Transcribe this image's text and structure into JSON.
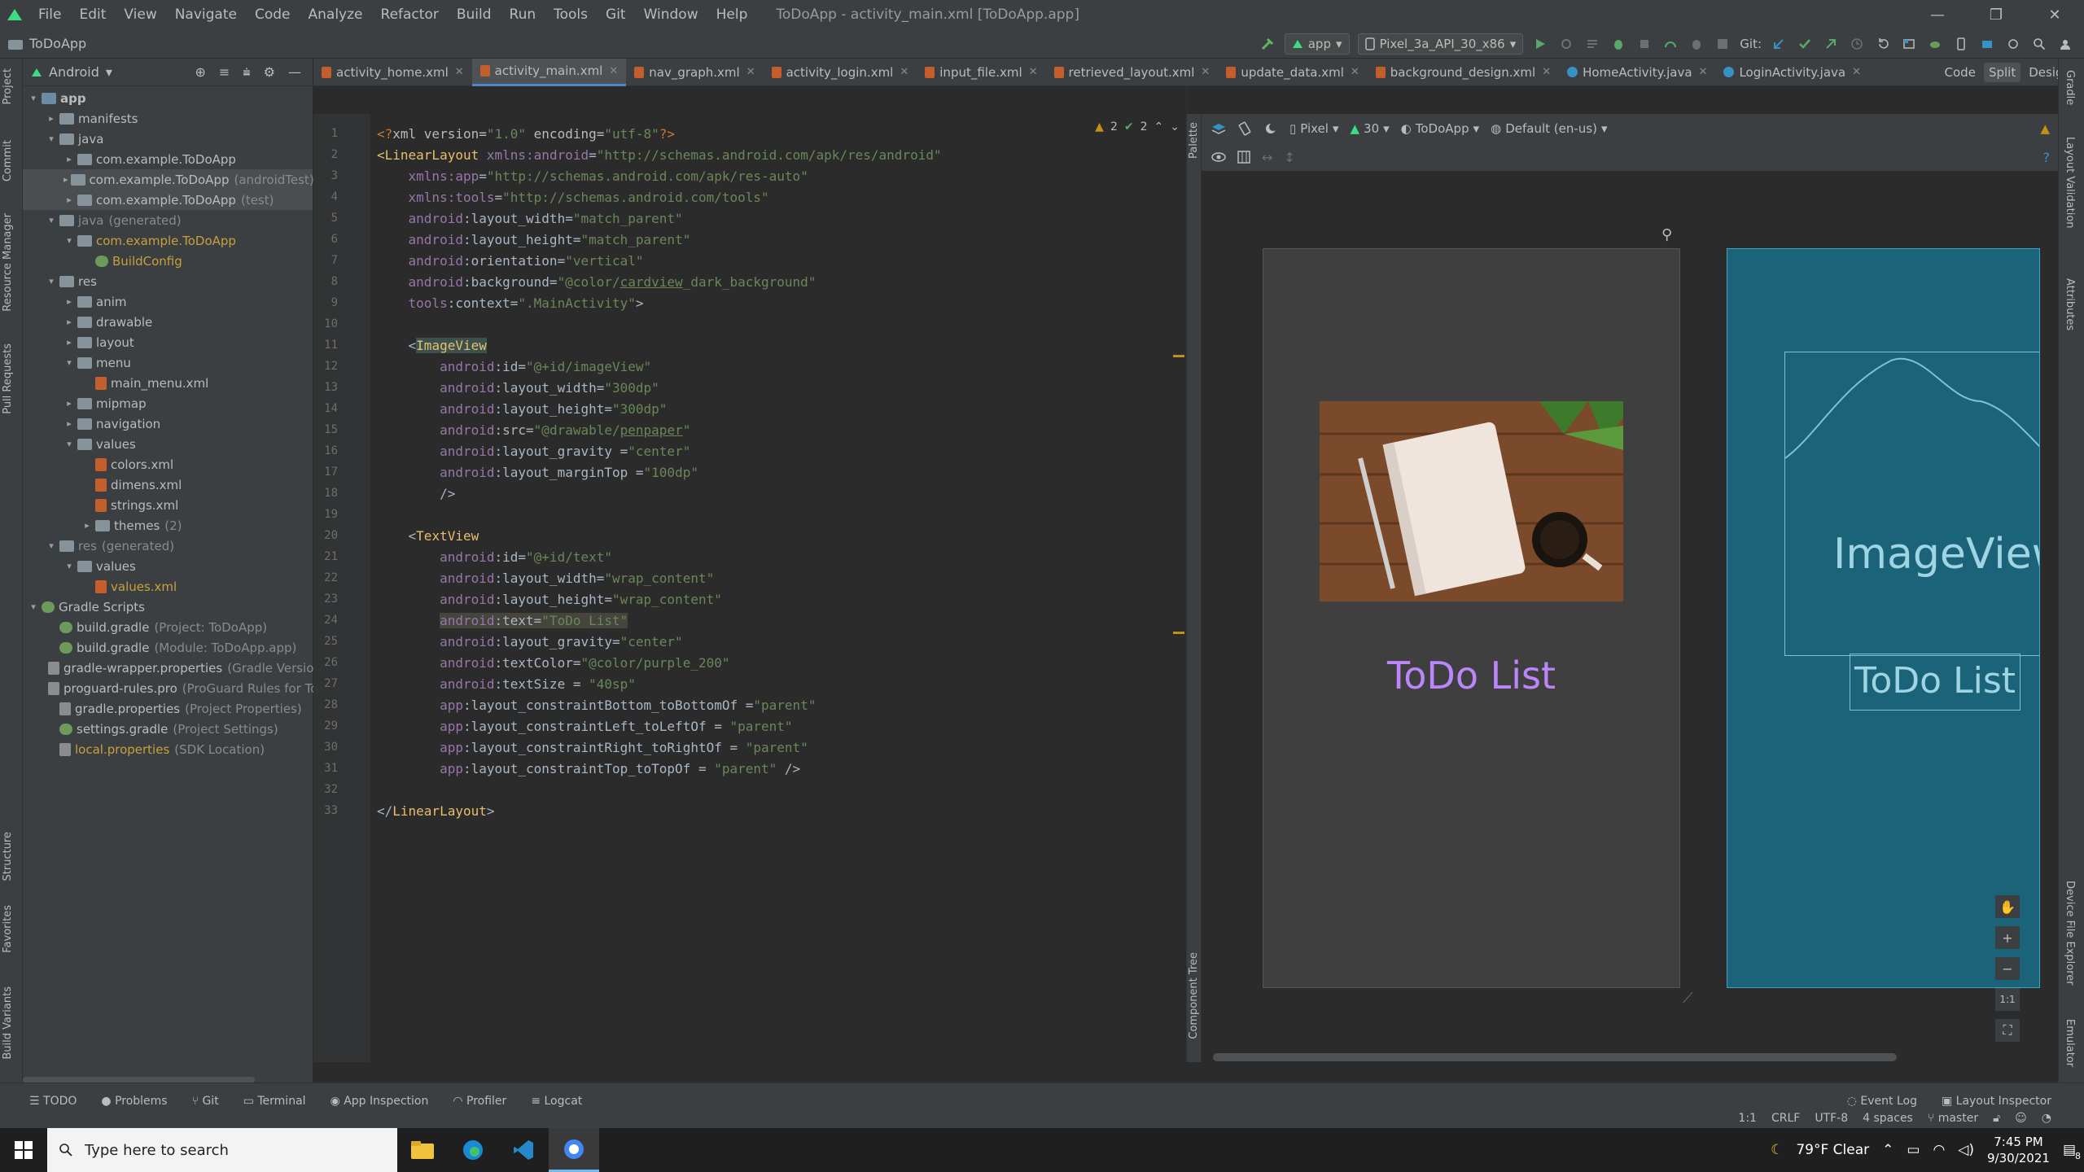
{
  "menubar": {
    "items": [
      "File",
      "Edit",
      "View",
      "Navigate",
      "Code",
      "Analyze",
      "Refactor",
      "Build",
      "Run",
      "Tools",
      "Git",
      "Window",
      "Help"
    ],
    "title": "ToDoApp - activity_main.xml [ToDoApp.app]",
    "controls": [
      "—",
      "❐",
      "✕"
    ]
  },
  "navbar": {
    "project_name": "ToDoApp",
    "run_config": "app",
    "device": "Pixel_3a_API_30_x86",
    "git_label": "Git:"
  },
  "left_stripe": [
    "Project",
    "Commit",
    "Resource Manager",
    "Pull Requests",
    "Structure",
    "Favorites",
    "Build Variants"
  ],
  "right_stripe": [
    "Gradle",
    "Layout Validation",
    "Attributes",
    "Device File Explorer",
    "Emulator"
  ],
  "project_panel": {
    "view_mode": "Android",
    "tree": [
      {
        "depth": 0,
        "arrow": "▾",
        "icon": "folder-b",
        "label": "app",
        "bold": true
      },
      {
        "depth": 1,
        "arrow": "▸",
        "icon": "folder",
        "label": "manifests"
      },
      {
        "depth": 1,
        "arrow": "▾",
        "icon": "folder",
        "label": "java"
      },
      {
        "depth": 2,
        "arrow": "▸",
        "icon": "folder",
        "label": "com.example.ToDoApp"
      },
      {
        "depth": 2,
        "arrow": "▸",
        "icon": "folder",
        "label": "com.example.ToDoApp",
        "hint": "(androidTest)",
        "sel": true
      },
      {
        "depth": 2,
        "arrow": "▸",
        "icon": "folder",
        "label": "com.example.ToDoApp",
        "hint": "(test)",
        "sel": true
      },
      {
        "depth": 1,
        "arrow": "▾",
        "icon": "folder",
        "label": "java",
        "hint": "(generated)",
        "muted": true
      },
      {
        "depth": 2,
        "arrow": "▾",
        "icon": "folder",
        "label": "com.example.ToDoApp",
        "yellow": true
      },
      {
        "depth": 3,
        "arrow": "",
        "icon": "gradle",
        "label": "BuildConfig",
        "yellow": true
      },
      {
        "depth": 1,
        "arrow": "▾",
        "icon": "folder",
        "label": "res"
      },
      {
        "depth": 2,
        "arrow": "▸",
        "icon": "folder",
        "label": "anim"
      },
      {
        "depth": 2,
        "arrow": "▸",
        "icon": "folder",
        "label": "drawable"
      },
      {
        "depth": 2,
        "arrow": "▸",
        "icon": "folder",
        "label": "layout"
      },
      {
        "depth": 2,
        "arrow": "▾",
        "icon": "folder",
        "label": "menu"
      },
      {
        "depth": 3,
        "arrow": "",
        "icon": "xml",
        "label": "main_menu.xml"
      },
      {
        "depth": 2,
        "arrow": "▸",
        "icon": "folder",
        "label": "mipmap"
      },
      {
        "depth": 2,
        "arrow": "▸",
        "icon": "folder",
        "label": "navigation"
      },
      {
        "depth": 2,
        "arrow": "▾",
        "icon": "folder",
        "label": "values"
      },
      {
        "depth": 3,
        "arrow": "",
        "icon": "xml",
        "label": "colors.xml"
      },
      {
        "depth": 3,
        "arrow": "",
        "icon": "xml",
        "label": "dimens.xml"
      },
      {
        "depth": 3,
        "arrow": "",
        "icon": "xml",
        "label": "strings.xml"
      },
      {
        "depth": 3,
        "arrow": "▸",
        "icon": "folder",
        "label": "themes",
        "hint": "(2)"
      },
      {
        "depth": 1,
        "arrow": "▾",
        "icon": "folder",
        "label": "res",
        "hint": "(generated)",
        "muted": true
      },
      {
        "depth": 2,
        "arrow": "▾",
        "icon": "folder",
        "label": "values"
      },
      {
        "depth": 3,
        "arrow": "",
        "icon": "xml",
        "label": "values.xml",
        "yellow": true
      },
      {
        "depth": 0,
        "arrow": "▾",
        "icon": "gradle",
        "label": "Gradle Scripts"
      },
      {
        "depth": 1,
        "arrow": "",
        "icon": "gradle",
        "label": "build.gradle",
        "hint": "(Project: ToDoApp)"
      },
      {
        "depth": 1,
        "arrow": "",
        "icon": "gradle",
        "label": "build.gradle",
        "hint": "(Module: ToDoApp.app)"
      },
      {
        "depth": 1,
        "arrow": "",
        "icon": "props",
        "label": "gradle-wrapper.properties",
        "hint": "(Gradle Version"
      },
      {
        "depth": 1,
        "arrow": "",
        "icon": "props",
        "label": "proguard-rules.pro",
        "hint": "(ProGuard Rules for To"
      },
      {
        "depth": 1,
        "arrow": "",
        "icon": "props",
        "label": "gradle.properties",
        "hint": "(Project Properties)"
      },
      {
        "depth": 1,
        "arrow": "",
        "icon": "gradle",
        "label": "settings.gradle",
        "hint": "(Project Settings)"
      },
      {
        "depth": 1,
        "arrow": "",
        "icon": "props",
        "label": "local.properties",
        "hint": "(SDK Location)",
        "yellow": true
      }
    ]
  },
  "tabs": [
    {
      "label": "activity_home.xml",
      "kind": "xml"
    },
    {
      "label": "activity_main.xml",
      "kind": "xml",
      "active": true
    },
    {
      "label": "nav_graph.xml",
      "kind": "xml"
    },
    {
      "label": "activity_login.xml",
      "kind": "xml"
    },
    {
      "label": "input_file.xml",
      "kind": "xml"
    },
    {
      "label": "retrieved_layout.xml",
      "kind": "xml"
    },
    {
      "label": "update_data.xml",
      "kind": "xml"
    },
    {
      "label": "background_design.xml",
      "kind": "xml"
    },
    {
      "label": "HomeActivity.java",
      "kind": "java"
    },
    {
      "label": "LoginActivity.java",
      "kind": "java"
    }
  ],
  "view_modes": {
    "code": "Code",
    "split": "Split",
    "design": "Design"
  },
  "inspection": {
    "warnings": "2",
    "weak": "2"
  },
  "code_lines": [
    {
      "n": "1",
      "html": "<span class='t-pi'>&lt;?</span><span class='t-attr'>xml version=</span><span class='t-val'>\"1.0\"</span><span class='t-attr'> encoding=</span><span class='t-val'>\"utf-8\"</span><span class='t-pi'>?&gt;</span>"
    },
    {
      "n": "2",
      "html": "<span class='t-tag'>&lt;LinearLayout</span> <span class='t-ns'>xmlns:android</span>=<span class='t-val'>\"http://schemas.android.com/apk/res/android\"</span>"
    },
    {
      "n": "3",
      "html": "    <span class='t-ns'>xmlns:app</span>=<span class='t-val'>\"http://schemas.android.com/apk/res-auto\"</span>"
    },
    {
      "n": "4",
      "html": "    <span class='t-ns'>xmlns:tools</span>=<span class='t-val'>\"http://schemas.android.com/tools\"</span>"
    },
    {
      "n": "5",
      "html": "    <span class='t-ns'>android</span>:layout_width=<span class='t-val'>\"match_parent\"</span>"
    },
    {
      "n": "6",
      "html": "    <span class='t-ns'>android</span>:layout_height=<span class='t-val'>\"match_parent\"</span>"
    },
    {
      "n": "7",
      "html": "    <span class='t-ns'>android</span>:orientation=<span class='t-val'>\"vertical\"</span>"
    },
    {
      "n": "8",
      "html": "    <span class='t-ns'>android</span>:background=<span class='t-val'>\"@color/<u>cardview</u>_dark_background\"</span>"
    },
    {
      "n": "9",
      "html": "    <span class='t-ns'>tools</span>:context=<span class='t-val'>\".MainActivity\"</span>&gt;"
    },
    {
      "n": "10",
      "html": ""
    },
    {
      "n": "11",
      "html": "    &lt;<span class='t-tag hl-tag'>ImageView</span>"
    },
    {
      "n": "12",
      "html": "        <span class='t-ns'>android</span>:id=<span class='t-val'>\"@+id/imageView\"</span>"
    },
    {
      "n": "13",
      "html": "        <span class='t-ns'>android</span>:layout_width=<span class='t-val'>\"300dp\"</span>"
    },
    {
      "n": "14",
      "html": "        <span class='t-ns'>android</span>:layout_height=<span class='t-val'>\"300dp\"</span>"
    },
    {
      "n": "15",
      "html": "        <span class='t-ns'>android</span>:src=<span class='t-val'>\"@drawable/<u>penpaper</u>\"</span>"
    },
    {
      "n": "16",
      "html": "        <span class='t-ns'>android</span>:layout_gravity =<span class='t-val'>\"center\"</span>"
    },
    {
      "n": "17",
      "html": "        <span class='t-ns'>android</span>:layout_marginTop =<span class='t-val'>\"100dp\"</span>"
    },
    {
      "n": "18",
      "html": "        /&gt;"
    },
    {
      "n": "19",
      "html": ""
    },
    {
      "n": "20",
      "html": "    &lt;<span class='t-tag'>TextView</span>"
    },
    {
      "n": "21",
      "html": "        <span class='t-ns'>android</span>:id=<span class='t-val'>\"@+id/text\"</span>"
    },
    {
      "n": "22",
      "html": "        <span class='t-ns'>android</span>:layout_width=<span class='t-val'>\"wrap_content\"</span>"
    },
    {
      "n": "23",
      "html": "        <span class='t-ns'>android</span>:layout_height=<span class='t-val'>\"wrap_content\"</span>"
    },
    {
      "n": "24",
      "html": "        <span class='hl-text'><span class='t-ns'>android</span>:text=<span class='t-val'>\"ToDo List\"</span></span>"
    },
    {
      "n": "25",
      "html": "        <span class='t-ns'>android</span>:layout_gravity=<span class='t-val'>\"center\"</span>"
    },
    {
      "n": "26",
      "html": "        <span class='t-ns'>android</span>:textColor=<span class='t-val'>\"@color/purple_200\"</span>"
    },
    {
      "n": "27",
      "html": "        <span class='t-ns'>android</span>:textSize = <span class='t-val'>\"40sp\"</span>"
    },
    {
      "n": "28",
      "html": "        <span class='t-ns'>app</span>:layout_constraintBottom_toBottomOf =<span class='t-val'>\"parent\"</span>"
    },
    {
      "n": "29",
      "html": "        <span class='t-ns'>app</span>:layout_constraintLeft_toLeftOf = <span class='t-val'>\"parent\"</span>"
    },
    {
      "n": "30",
      "html": "        <span class='t-ns'>app</span>:layout_constraintRight_toRightOf = <span class='t-val'>\"parent\"</span>"
    },
    {
      "n": "31",
      "html": "        <span class='t-ns'>app</span>:layout_constraintTop_toTopOf = <span class='t-val'>\"parent\"</span> /&gt;"
    },
    {
      "n": "32",
      "html": ""
    },
    {
      "n": "33",
      "html": "&lt;/<span class='t-tag'>LinearLayout</span>&gt;"
    }
  ],
  "design": {
    "device": "Pixel",
    "api": "30",
    "theme": "ToDoApp",
    "locale": "Default (en-us)",
    "text_preview": "ToDo List",
    "blueprint_image_label": "ImageView",
    "blueprint_text": "ToDo List",
    "zoom_fit": "1:1"
  },
  "bottom_tools": [
    "TODO",
    "Problems",
    "Git",
    "Terminal",
    "App Inspection",
    "Profiler",
    "Logcat"
  ],
  "bottom_right": [
    "Event Log",
    "Layout Inspector"
  ],
  "status": {
    "position": "1:1",
    "line_sep": "CRLF",
    "encoding": "UTF-8",
    "indent": "4 spaces",
    "branch": "master"
  },
  "taskbar": {
    "search_placeholder": "Type here to search",
    "weather": "79°F  Clear",
    "time": "7:45 PM",
    "date": "9/30/2021",
    "notif_count": "8"
  },
  "colors": {
    "accent": "#4a88c7",
    "preview_text": "#bb86fc",
    "blueprint_bg": "#1b6379"
  }
}
